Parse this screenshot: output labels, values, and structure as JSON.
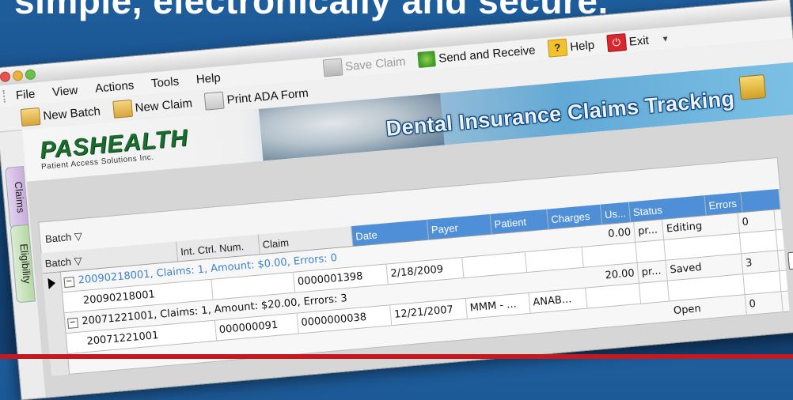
{
  "headline": "simple, electronically and secure.",
  "colors": {
    "page_bg": "#1e5d9c",
    "grid_header": "#4f8fd7",
    "accent_red": "#c31a22",
    "logo_green": "#1b6d2f"
  },
  "menu": [
    "File",
    "View",
    "Actions",
    "Tools",
    "Help"
  ],
  "toolbar_top": {
    "save_claim": "Save Claim",
    "send_receive": "Send and Receive",
    "help": "Help",
    "exit": "Exit"
  },
  "toolbar2": {
    "new_batch": "New Batch",
    "new_claim": "New Claim",
    "print_ada": "Print ADA Form"
  },
  "side_tabs": {
    "claims": "Claims",
    "eligibility": "Eligibility"
  },
  "banner": {
    "logo": "PASHEALTH",
    "logo_sub": "Patient Access Solutions Inc.",
    "title": "Dental Insurance Claims Tracking"
  },
  "grid": {
    "group_by": "Batch",
    "columns": {
      "batch": "Batch",
      "int_ctrl": "Int. Ctrl. Num.",
      "claim": "Claim",
      "date": "Date",
      "payer": "Payer",
      "patient": "Patient",
      "charges": "Charges",
      "us": "Us...",
      "status": "Status",
      "errors": "Errors"
    },
    "groups": [
      {
        "label": "20090218001, Claims: 1, Amount: $0.00, Errors: 0",
        "child": {
          "batch": "20090218001",
          "claim": "0000001398",
          "date": "2/18/2009",
          "charges": "0.00",
          "us": "pr...",
          "status": "Editing",
          "errors": "0"
        }
      },
      {
        "label": "20071221001, Claims: 1, Amount: $20.00, Errors: 3",
        "child": {
          "batch": "20071221001",
          "int_ctrl": "000000091",
          "claim": "0000000038",
          "date": "12/21/2007",
          "payer": "MMM - ...",
          "patient": "ANAB...",
          "charges": "20.00",
          "us": "pr...",
          "status": "Saved",
          "errors": "3"
        }
      },
      {
        "label": "",
        "child": {
          "status": "Open",
          "errors": "0"
        }
      }
    ]
  }
}
